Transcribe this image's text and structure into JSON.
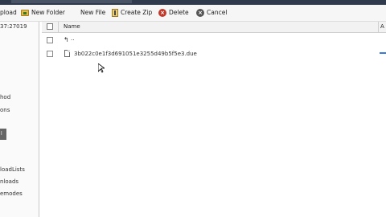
{
  "titlebar": {
    "text": ""
  },
  "toolbar": {
    "upload_label": "pload",
    "new_folder_label": "New Folder",
    "new_file_label": "New File",
    "create_zip_label": "Create Zip",
    "delete_label": "Delete",
    "cancel_label": "Cancel"
  },
  "sidebar": {
    "items": [
      "37:27019",
      "hod",
      "ons",
      "loadLists",
      "nloads",
      "emodes"
    ],
    "square_text": "l"
  },
  "table": {
    "headers": {
      "name": "Name",
      "extra": "A"
    },
    "up_label": "..",
    "rows": [
      {
        "name": "3b022c0e1f3d691051e3255d49b5f5e3.due"
      }
    ]
  },
  "colors": {
    "accent": "#3a7bd5",
    "titlebar": "#2f3b4d",
    "delete": "#c0392b"
  }
}
